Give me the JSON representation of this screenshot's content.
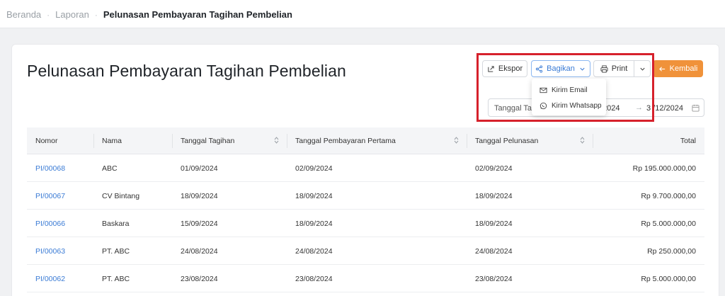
{
  "breadcrumb": {
    "items": [
      "Beranda",
      "Laporan"
    ],
    "current": "Pelunasan Pembayaran Tagihan Pembelian"
  },
  "page": {
    "title": "Pelunasan Pembayaran Tagihan Pembelian"
  },
  "toolbar": {
    "ekspor_label": "Ekspor",
    "bagikan_label": "Bagikan",
    "print_label": "Print",
    "kembali_label": "Kembali",
    "share_menu": [
      {
        "label": "Kirim Email",
        "icon": "mail-icon"
      },
      {
        "label": "Kirim Whatsapp",
        "icon": "whatsapp-icon"
      }
    ]
  },
  "date_filter": {
    "label": "Tanggal Tagi",
    "start": "/2024",
    "end": "3  /12/2024"
  },
  "table": {
    "columns": [
      "Nomor",
      "Nama",
      "Tanggal Tagihan",
      "Tanggal Pembayaran Pertama",
      "Tanggal Pelunasan",
      "Total"
    ],
    "rows": [
      {
        "nomor": "PI/00068",
        "nama": "ABC",
        "tagihan": "01/09/2024",
        "pertama": "02/09/2024",
        "pelunasan": "02/09/2024",
        "total": "Rp 195.000.000,00"
      },
      {
        "nomor": "PI/00067",
        "nama": "CV Bintang",
        "tagihan": "18/09/2024",
        "pertama": "18/09/2024",
        "pelunasan": "18/09/2024",
        "total": "Rp 9.700.000,00"
      },
      {
        "nomor": "PI/00066",
        "nama": "Baskara",
        "tagihan": "15/09/2024",
        "pertama": "18/09/2024",
        "pelunasan": "18/09/2024",
        "total": "Rp 5.000.000,00"
      },
      {
        "nomor": "PI/00063",
        "nama": "PT. ABC",
        "tagihan": "24/08/2024",
        "pertama": "24/08/2024",
        "pelunasan": "24/08/2024",
        "total": "Rp 250.000,00"
      },
      {
        "nomor": "PI/00062",
        "nama": "PT. ABC",
        "tagihan": "23/08/2024",
        "pertama": "23/08/2024",
        "pelunasan": "23/08/2024",
        "total": "Rp 5.000.000,00"
      }
    ]
  },
  "colors": {
    "accent": "#3a7bd5",
    "kembali": "#f0923a",
    "highlight": "#d6212c"
  }
}
